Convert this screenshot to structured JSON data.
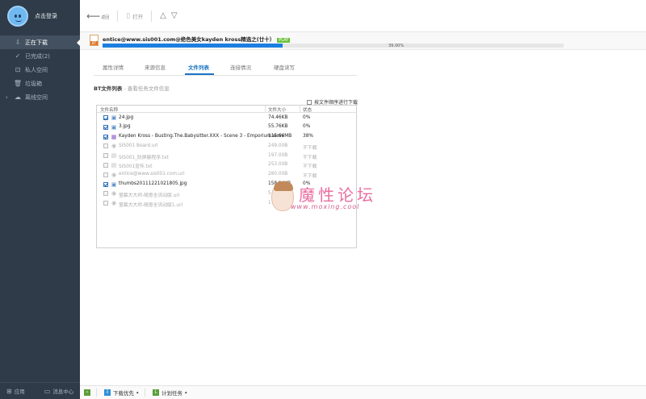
{
  "sidebar": {
    "login_text": "点击登录",
    "items": [
      {
        "label": "正在下载",
        "icon": "download-icon",
        "glyph": "⇩",
        "active": true
      },
      {
        "label": "已完成(2)",
        "icon": "check-circle-icon",
        "glyph": "✓",
        "active": false
      },
      {
        "label": "私人空间",
        "icon": "lock-icon",
        "glyph": "⊡",
        "active": false
      },
      {
        "label": "垃圾箱",
        "icon": "trash-icon",
        "glyph": "🗑",
        "active": false
      },
      {
        "label": "离线空间",
        "icon": "cloud-offline-icon",
        "glyph": "☁",
        "active": false,
        "expandable": true
      }
    ],
    "footer": {
      "apps_label": "应用",
      "msg_label": "消息中心"
    }
  },
  "toolbar": {
    "back_label": "返回",
    "open_label": "打开"
  },
  "download": {
    "name": "entice@www.sis001.com@绝色美女kayden kross精选之(廿十）",
    "badge": "PLAY",
    "progress": 0.39,
    "progress_text": "39.00%"
  },
  "tabs": [
    {
      "label": "属性详情",
      "active": false
    },
    {
      "label": "来源信息",
      "active": false
    },
    {
      "label": "文件列表",
      "active": true
    },
    {
      "label": "连接情况",
      "active": false
    },
    {
      "label": "硬盘读写",
      "active": false
    }
  ],
  "section": {
    "title": "BT文件列表",
    "subtitle": "- 查看任务文件信息"
  },
  "order_check_label": "按文件顺序进行下载",
  "file_table": {
    "headers": {
      "name": "文件名称",
      "size": "文件大小",
      "status": "状态"
    },
    "rows": [
      {
        "name": "24.jpg",
        "size": "74.46KB",
        "status": "0%",
        "checked": true,
        "enabled": true,
        "icon": "image-file-icon"
      },
      {
        "name": "3.jpg",
        "size": "55.76KB",
        "status": "0%",
        "checked": true,
        "enabled": true,
        "icon": "image-file-icon"
      },
      {
        "name": "Kayden Kross - Busting.The.Babysitter.XXX - Scene 3 - Emporium.wmv",
        "size": "115.66MB",
        "status": "38%",
        "checked": true,
        "enabled": true,
        "icon": "video-file-icon"
      },
      {
        "name": "SIS001 Board.url",
        "size": "249.00B",
        "status": "不下载",
        "checked": false,
        "enabled": false,
        "icon": "web-link-icon"
      },
      {
        "name": "SIS001_防屏蔽程序.txt",
        "size": "197.00B",
        "status": "不下载",
        "checked": false,
        "enabled": false,
        "icon": "text-file-icon"
      },
      {
        "name": "SIS001宣传.txt",
        "size": "253.00B",
        "status": "不下载",
        "checked": false,
        "enabled": false,
        "icon": "text-file-icon"
      },
      {
        "name": "entice@www.sis001.com.url",
        "size": "280.00B",
        "status": "不下载",
        "checked": false,
        "enabled": false,
        "icon": "web-link-icon"
      },
      {
        "name": "thumbs20111221021805.jpg",
        "size": "158.24KB",
        "status": "0%",
        "checked": true,
        "enabled": true,
        "icon": "image-file-icon"
      },
      {
        "name": "萤幕大大师-随意全流动版.url",
        "size": "5",
        "status": "",
        "checked": false,
        "enabled": false,
        "icon": "web-link-icon"
      },
      {
        "name": "萤幕大大师-随意全流动版1.url",
        "size": "1",
        "status": "",
        "checked": false,
        "enabled": false,
        "icon": "web-link-icon"
      }
    ]
  },
  "watermark": {
    "title": "魔性论坛",
    "url": "www.moxing.cool"
  },
  "statusbar": {
    "priority_label": "下载优先",
    "schedule_label": "计划任务"
  },
  "colors": {
    "sidebar_bg": "#2f3b49",
    "accent": "#1a74c4",
    "progress": "#1c7fe0"
  }
}
